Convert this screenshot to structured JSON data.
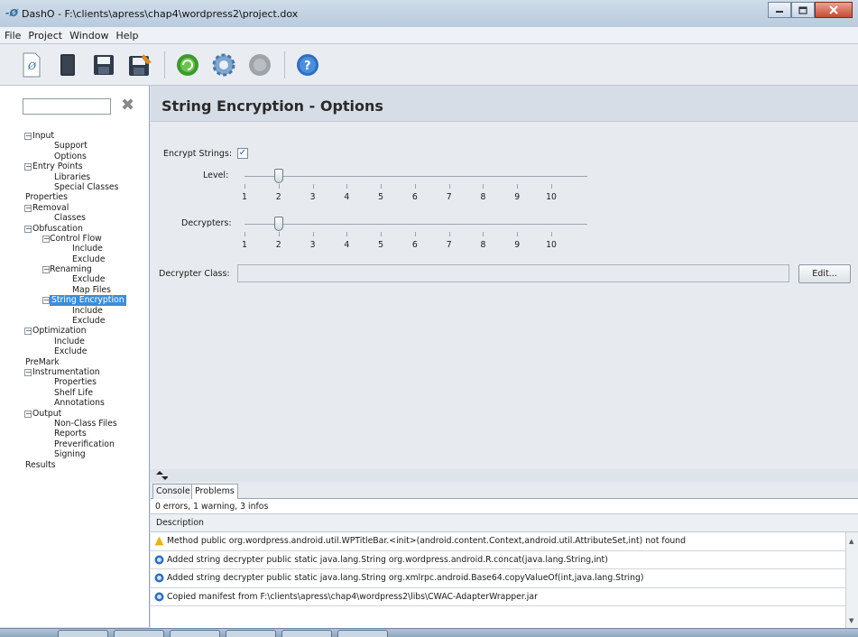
{
  "window": {
    "title": "DashO - F:\\clients\\apress\\chap4\\wordpress2\\project.dox",
    "app_icon_glyph": "-Ø"
  },
  "menu": [
    "File",
    "Project",
    "Window",
    "Help"
  ],
  "toolbar": {
    "icons": [
      "new-project-icon",
      "open-project-icon",
      "save-icon",
      "save-as-icon",
      "build-icon",
      "settings-icon",
      "stop-icon",
      "help-icon"
    ]
  },
  "sidebar": {
    "search_value": "",
    "clear_glyph": "✖",
    "tree": [
      {
        "label": "Input",
        "level": 0,
        "expander": "−"
      },
      {
        "label": "Support",
        "level": 1
      },
      {
        "label": "Options",
        "level": 1
      },
      {
        "label": "Entry Points",
        "level": 0,
        "expander": "−"
      },
      {
        "label": "Libraries",
        "level": 1
      },
      {
        "label": "Special Classes",
        "level": 1
      },
      {
        "label": "Properties",
        "level": 0
      },
      {
        "label": "Removal",
        "level": 0,
        "expander": "−"
      },
      {
        "label": "Classes",
        "level": 1
      },
      {
        "label": "Obfuscation",
        "level": 0,
        "expander": "−"
      },
      {
        "label": "Control Flow",
        "level": 1,
        "expander": "−"
      },
      {
        "label": "Include",
        "level": 2
      },
      {
        "label": "Exclude",
        "level": 2
      },
      {
        "label": "Renaming",
        "level": 1,
        "expander": "−"
      },
      {
        "label": "Exclude",
        "level": 2
      },
      {
        "label": "Map Files",
        "level": 2
      },
      {
        "label": "String Encryption",
        "level": 1,
        "expander": "−",
        "selected": true
      },
      {
        "label": "Include",
        "level": 2
      },
      {
        "label": "Exclude",
        "level": 2
      },
      {
        "label": "Optimization",
        "level": 0,
        "expander": "−"
      },
      {
        "label": "Include",
        "level": 1
      },
      {
        "label": "Exclude",
        "level": 1
      },
      {
        "label": "PreMark",
        "level": 0
      },
      {
        "label": "Instrumentation",
        "level": 0,
        "expander": "−"
      },
      {
        "label": "Properties",
        "level": 1
      },
      {
        "label": "Shelf Life",
        "level": 1
      },
      {
        "label": "Annotations",
        "level": 1
      },
      {
        "label": "Output",
        "level": 0,
        "expander": "−"
      },
      {
        "label": "Non-Class Files",
        "level": 1
      },
      {
        "label": "Reports",
        "level": 1
      },
      {
        "label": "Preverification",
        "level": 1
      },
      {
        "label": "Signing",
        "level": 1
      },
      {
        "label": "Results",
        "level": 0
      }
    ]
  },
  "main": {
    "heading": "String Encryption - Options",
    "encrypt_label": "Encrypt Strings:",
    "encrypt_checked": true,
    "check_glyph": "✓",
    "level_label": "Level:",
    "level_value": 2,
    "decrypters_label": "Decrypters:",
    "decrypters_value": 2,
    "scale": [
      "1",
      "2",
      "3",
      "4",
      "5",
      "6",
      "7",
      "8",
      "9",
      "10"
    ],
    "decrypter_class_label": "Decrypter Class:",
    "decrypter_class_value": "",
    "edit_button": "Edit..."
  },
  "bottom": {
    "tabs": [
      "Console",
      "Problems"
    ],
    "active_tab": 1,
    "summary": "0 errors, 1 warning, 3 infos",
    "column_header": "Description",
    "problems": [
      {
        "type": "warning",
        "text": "Method public org.wordpress.android.util.WPTitleBar.<init>(android.content.Context,android.util.AttributeSet,int) not found"
      },
      {
        "type": "info",
        "text": "Added string decrypter public static java.lang.String org.wordpress.android.R.concat(java.lang.String,int)"
      },
      {
        "type": "info",
        "text": "Added string decrypter public static java.lang.String org.xmlrpc.android.Base64.copyValueOf(int,java.lang.String)"
      },
      {
        "type": "info",
        "text": "Copied manifest from F:\\clients\\apress\\chap4\\wordpress2\\libs\\CWAC-AdapterWrapper.jar"
      }
    ]
  },
  "colors": {
    "accent": "#3b8ed8",
    "warning": "#e7b416",
    "info": "#2d6fc0"
  }
}
